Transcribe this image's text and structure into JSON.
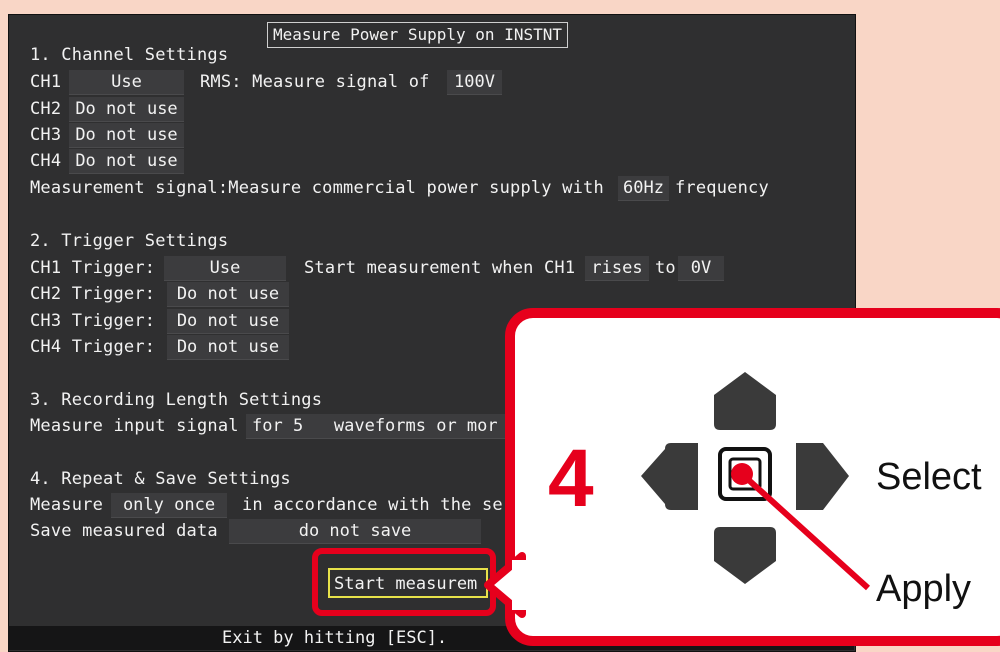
{
  "screen": {
    "title": "Measure Power Supply on INSTNT",
    "channel_settings": {
      "heading": "1. Channel Settings",
      "ch1": {
        "label": "CH1",
        "value": "Use",
        "rms_text": "RMS: Measure signal of",
        "rms_value": "100V"
      },
      "ch2": {
        "label": "CH2",
        "value": "Do not use"
      },
      "ch3": {
        "label": "CH3",
        "value": "Do not use"
      },
      "ch4": {
        "label": "CH4",
        "value": "Do not use"
      },
      "signal_text_before": "Measurement signal:Measure commercial power supply with",
      "frequency_value": "60Hz",
      "signal_text_after": "frequency"
    },
    "trigger_settings": {
      "heading": "2. Trigger Settings",
      "ch1": {
        "label": "CH1 Trigger:",
        "value": "Use",
        "condition_text": "Start measurement when CH1",
        "edge_value": "rises",
        "to_text": "to",
        "level_value": "0V"
      },
      "ch2": {
        "label": "CH2 Trigger:",
        "value": "Do not use"
      },
      "ch3": {
        "label": "CH3 Trigger:",
        "value": "Do not use"
      },
      "ch4": {
        "label": "CH4 Trigger:",
        "value": "Do not use"
      }
    },
    "recording_settings": {
      "heading": "3. Recording Length Settings",
      "text": "Measure input signal",
      "value": "for 5   waveforms or mor"
    },
    "repeat_settings": {
      "heading": "4. Repeat & Save Settings",
      "measure_text": "Measure",
      "measure_value": "only once",
      "accordance_text": "in accordance with the se",
      "save_text": "Save measured data",
      "save_value": "do not save"
    },
    "start_button": "Start measurem",
    "footer": "Exit by hitting [ESC]."
  },
  "callout": {
    "step": "4",
    "select_label": "Select",
    "apply_label": "Apply"
  },
  "colors": {
    "accent_red": "#e6001c",
    "screen_bg": "#2f2f30",
    "field_bg": "#3c3c3e",
    "page_bg": "#f9d6c6",
    "highlight_yellow": "#e8e24a"
  },
  "icons": [
    "up-arrow-key-icon",
    "down-arrow-key-icon",
    "left-arrow-key-icon",
    "right-arrow-key-icon",
    "center-select-key-icon"
  ]
}
